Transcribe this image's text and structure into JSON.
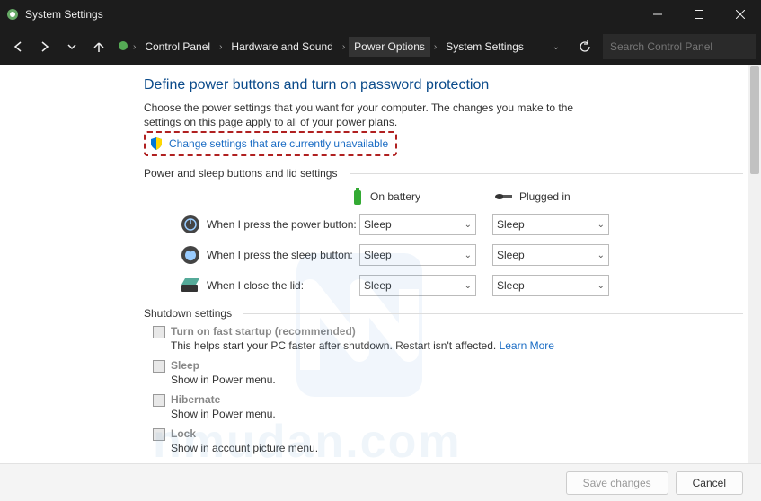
{
  "window": {
    "title": "System Settings"
  },
  "breadcrumb": {
    "items": [
      "Control Panel",
      "Hardware and Sound",
      "Power Options",
      "System Settings"
    ],
    "active": 2
  },
  "search": {
    "placeholder": "Search Control Panel"
  },
  "main": {
    "heading": "Define power buttons and turn on password protection",
    "description": "Choose the power settings that you want for your computer. The changes you make to the settings on this page apply to all of your power plans.",
    "change_link": "Change settings that are currently unavailable",
    "section1": "Power and sleep buttons and lid settings",
    "columns": {
      "battery": "On battery",
      "plugged": "Plugged in"
    },
    "rows": [
      {
        "label": "When I press the power button:",
        "battery": "Sleep",
        "plugged": "Sleep"
      },
      {
        "label": "When I press the sleep button:",
        "battery": "Sleep",
        "plugged": "Sleep"
      },
      {
        "label": "When I close the lid:",
        "battery": "Sleep",
        "plugged": "Sleep"
      }
    ],
    "shutdown_h": "Shutdown settings",
    "shutdown": [
      {
        "title": "Turn on fast startup (recommended)",
        "sub": "This helps start your PC faster after shutdown. Restart isn't affected.",
        "link": "Learn More"
      },
      {
        "title": "Sleep",
        "sub": "Show in Power menu."
      },
      {
        "title": "Hibernate",
        "sub": "Show in Power menu."
      },
      {
        "title": "Lock",
        "sub": "Show in account picture menu."
      }
    ]
  },
  "footer": {
    "save": "Save changes",
    "cancel": "Cancel"
  },
  "watermark": "nmudan.com"
}
